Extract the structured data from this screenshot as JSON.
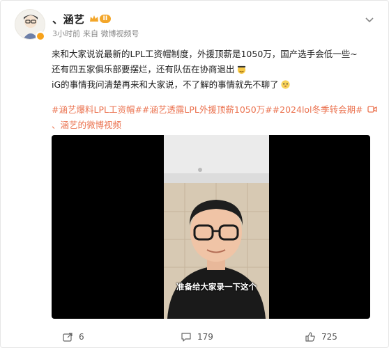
{
  "post": {
    "user": {
      "name": "、涵艺",
      "level_badge": "II"
    },
    "meta": {
      "time": "3小时前",
      "source": "来自 微博视频号"
    },
    "text_lines": [
      "来和大家说说最新的LPL工资帽制度，外援顶薪是1050万，国产选手会低一些~",
      "还有四五家俱乐部要摆烂，还有队伍在协商退出",
      "iG的事情我问清楚再来和大家说，不了解的事情就先不聊了"
    ],
    "tags": [
      "#涵艺爆料LPL工资帽#",
      "#涵艺透露LPL外援顶薪1050万#",
      "#2024lol冬季转会期#"
    ],
    "video_link_label": "、涵艺的微博视频",
    "video": {
      "subtitle": "准备给大家录一下这个"
    }
  },
  "actions": {
    "share_count": "6",
    "comment_count": "179",
    "like_count": "725"
  },
  "colors": {
    "link": "#eb7350",
    "badge": "#f3a629",
    "text": "#222222",
    "meta": "#888888"
  },
  "icons": [
    "avatar",
    "crown-icon",
    "chevron-down-icon",
    "emoji-smile-icon",
    "emoji-cute-icon",
    "video-camera-icon",
    "share-icon",
    "comment-icon",
    "like-icon"
  ]
}
